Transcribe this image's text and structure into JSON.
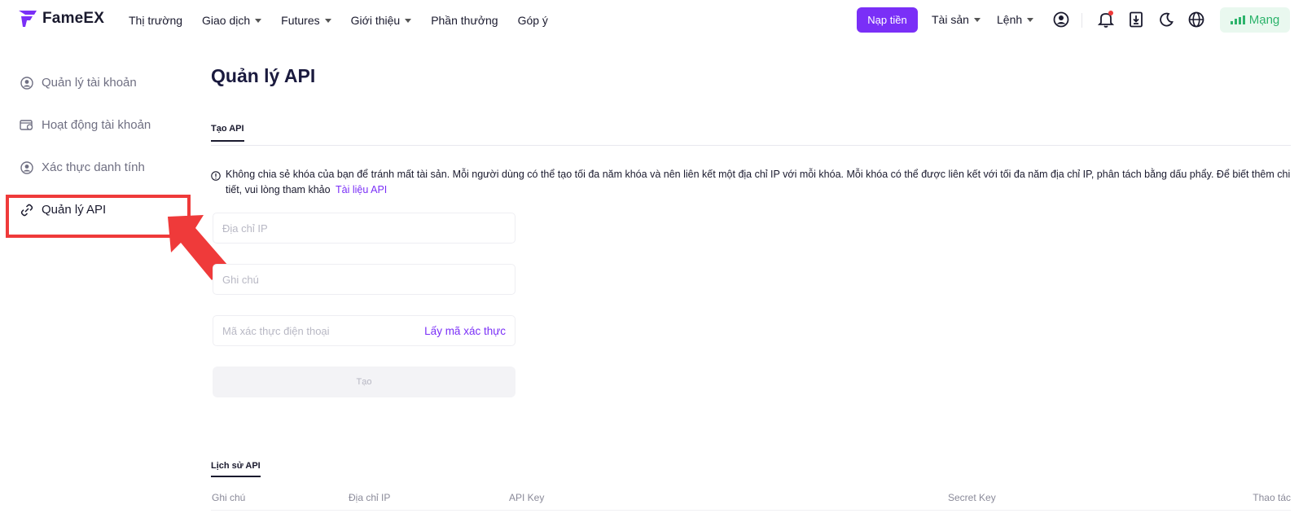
{
  "brand": {
    "name": "FameEX",
    "accent": "#7a2ff7"
  },
  "nav": {
    "market": "Thị trường",
    "trade": "Giao dịch",
    "futures": "Futures",
    "intro": "Giới thiệu",
    "rewards": "Phần thưởng",
    "feedback": "Góp ý"
  },
  "header_right": {
    "deposit": "Nạp tiền",
    "assets": "Tài sản",
    "orders": "Lệnh",
    "network": "Mạng",
    "icons": [
      "user-icon",
      "bell-icon",
      "download-icon",
      "moon-icon",
      "globe-icon"
    ]
  },
  "sidebar": {
    "items": [
      {
        "label": "Quản lý tài khoản",
        "icon": "user-circle-icon"
      },
      {
        "label": "Hoạt động tài khoản",
        "icon": "wallet-icon"
      },
      {
        "label": "Xác thực danh tính",
        "icon": "id-icon"
      },
      {
        "label": "Quản lý API",
        "icon": "link-icon",
        "active": true
      }
    ]
  },
  "main": {
    "title": "Quản lý API",
    "tab_create": "Tạo API",
    "notice_text": "Không chia sẻ khóa của bạn để tránh mất tài sản. Mỗi người dùng có thể tạo tối đa năm khóa và nên liên kết một địa chỉ IP với mỗi khóa. Mỗi khóa có thể được liên kết với tối đa năm địa chỉ IP, phân tách bằng dấu phẩy. Để biết thêm chi tiết, vui lòng tham khảo",
    "notice_link": "Tài liệu API",
    "form": {
      "ip_placeholder": "Địa chỉ IP",
      "note_placeholder": "Ghi chú",
      "phone_code_placeholder": "Mã xác thực điện thoại",
      "get_code": "Lấy mã xác thực",
      "create_button": "Tạo"
    },
    "history": {
      "tab": "Lịch sử API",
      "columns": [
        "Ghi chú",
        "Địa chỉ IP",
        "API Key",
        "Secret Key",
        "Thao tác"
      ]
    }
  },
  "colors": {
    "highlight_red": "#ef3a3a",
    "network_green": "#2cb36b"
  }
}
